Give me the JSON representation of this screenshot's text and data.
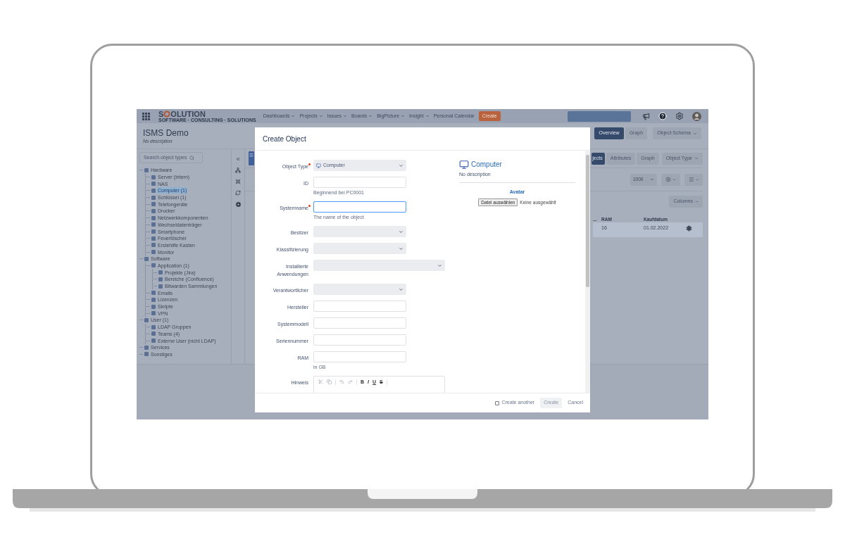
{
  "nav": {
    "logo_start": "S",
    "logo_end": "OLUTION",
    "tagline": "SOFTWARE · CONSULTING · SOLUTIONS",
    "menus": [
      {
        "label": "Dashboards",
        "dropdown": true
      },
      {
        "label": "Projects",
        "dropdown": true
      },
      {
        "label": "Issues",
        "dropdown": true
      },
      {
        "label": "Boards",
        "dropdown": true
      },
      {
        "label": "BigPicture",
        "dropdown": true
      },
      {
        "label": "Insight",
        "dropdown": true
      },
      {
        "label": "Personal Calendar",
        "dropdown": false
      }
    ],
    "create": "Create"
  },
  "schema": {
    "title": "ISMS Demo",
    "description": "No description",
    "search_placeholder": "Search object types"
  },
  "schema_tabs": [
    {
      "label": "Overview",
      "selected": true
    },
    {
      "label": "Graph",
      "selected": false
    }
  ],
  "schema_menu": "Object Schema",
  "tree": [
    {
      "label": "Hardware",
      "selected": false,
      "children": [
        {
          "label": "Server (Intern)",
          "selected": false
        },
        {
          "label": "NAS",
          "selected": false
        },
        {
          "label": "Computer (1)",
          "selected": true
        },
        {
          "label": "Schlüssel (1)",
          "selected": false
        },
        {
          "label": "Telefongeräte",
          "selected": false
        },
        {
          "label": "Drucker",
          "selected": false
        },
        {
          "label": "Netzwerkkomponenten",
          "selected": false
        },
        {
          "label": "Wechseldatenträger",
          "selected": false
        },
        {
          "label": "Smartphone",
          "selected": false
        },
        {
          "label": "Feuerlöscher",
          "selected": false
        },
        {
          "label": "Erstehilfe Kasten",
          "selected": false
        },
        {
          "label": "Monitor",
          "selected": false
        }
      ]
    },
    {
      "label": "Software",
      "selected": false,
      "children": [
        {
          "label": "Application (1)",
          "selected": false,
          "children": [
            {
              "label": "Projekte (Jira)",
              "selected": false
            },
            {
              "label": "Bereiche (Confluence)",
              "selected": false
            },
            {
              "label": "Bitwarden Sammlungen",
              "selected": false
            }
          ]
        },
        {
          "label": "Emails",
          "selected": false
        },
        {
          "label": "Lizenzen",
          "selected": false
        },
        {
          "label": "Skripte",
          "selected": false
        },
        {
          "label": "VPN",
          "selected": false
        }
      ]
    },
    {
      "label": "User (1)",
      "selected": false,
      "children": [
        {
          "label": "LDAP Gruppen",
          "selected": false
        },
        {
          "label": "Teams (4)",
          "selected": false
        },
        {
          "label": "Externe User (nicht LDAP)",
          "selected": false
        }
      ]
    },
    {
      "label": "Services",
      "selected": false
    },
    {
      "label": "Sonstiges",
      "selected": false
    }
  ],
  "type_tabs": [
    {
      "label": "jects",
      "selected": true
    },
    {
      "label": "Attributes",
      "selected": false
    },
    {
      "label": "Graph",
      "selected": false
    }
  ],
  "type_menu": "Object Type",
  "page_size": "1000",
  "columns_button": "Columns",
  "table": {
    "columns": [
      "...",
      "RAM",
      "Kaufdatum"
    ],
    "rows": [
      {
        "selected": true,
        "cells": [
          "",
          "16",
          "01.02.2022"
        ]
      }
    ]
  },
  "dialog": {
    "title": "Create Object",
    "fields": [
      {
        "label": "Object Type",
        "required": true,
        "focused": false,
        "kind": "select",
        "value": "Computer"
      },
      {
        "label": "ID",
        "required": false,
        "focused": false,
        "kind": "text",
        "hint": "Beginnend bei PC0001"
      },
      {
        "label": "Systemname",
        "required": true,
        "focused": true,
        "kind": "text",
        "hint": "The name of the object"
      },
      {
        "label": "Besitzer",
        "required": false,
        "focused": false,
        "kind": "select"
      },
      {
        "label": "Klassifizierung",
        "required": false,
        "focused": false,
        "kind": "select"
      },
      {
        "label": "Installierte Anwendungen",
        "required": false,
        "focused": false,
        "kind": "wide_select"
      },
      {
        "label": "Verantwortlicher",
        "required": false,
        "focused": false,
        "kind": "select"
      },
      {
        "label": "Hersteller",
        "required": false,
        "focused": false,
        "kind": "text"
      },
      {
        "label": "Systemmodell",
        "required": false,
        "focused": false,
        "kind": "text"
      },
      {
        "label": "Seriennummer",
        "required": false,
        "focused": false,
        "kind": "text"
      },
      {
        "label": "RAM",
        "required": false,
        "focused": false,
        "kind": "text",
        "hint": "in GB"
      },
      {
        "label": "Hinweis",
        "required": false,
        "focused": false,
        "kind": "richtext",
        "tools": [
          "B",
          "I",
          "U",
          "S"
        ]
      }
    ],
    "preview": {
      "title": "Computer",
      "description": "No description",
      "avatar_label": "Avatar",
      "file_button": "Datei auswählen",
      "file_status": "Keine ausgewählt"
    },
    "create_another": {
      "label": "Create another",
      "checked": false
    },
    "create": "Create",
    "cancel": "Cancel"
  }
}
